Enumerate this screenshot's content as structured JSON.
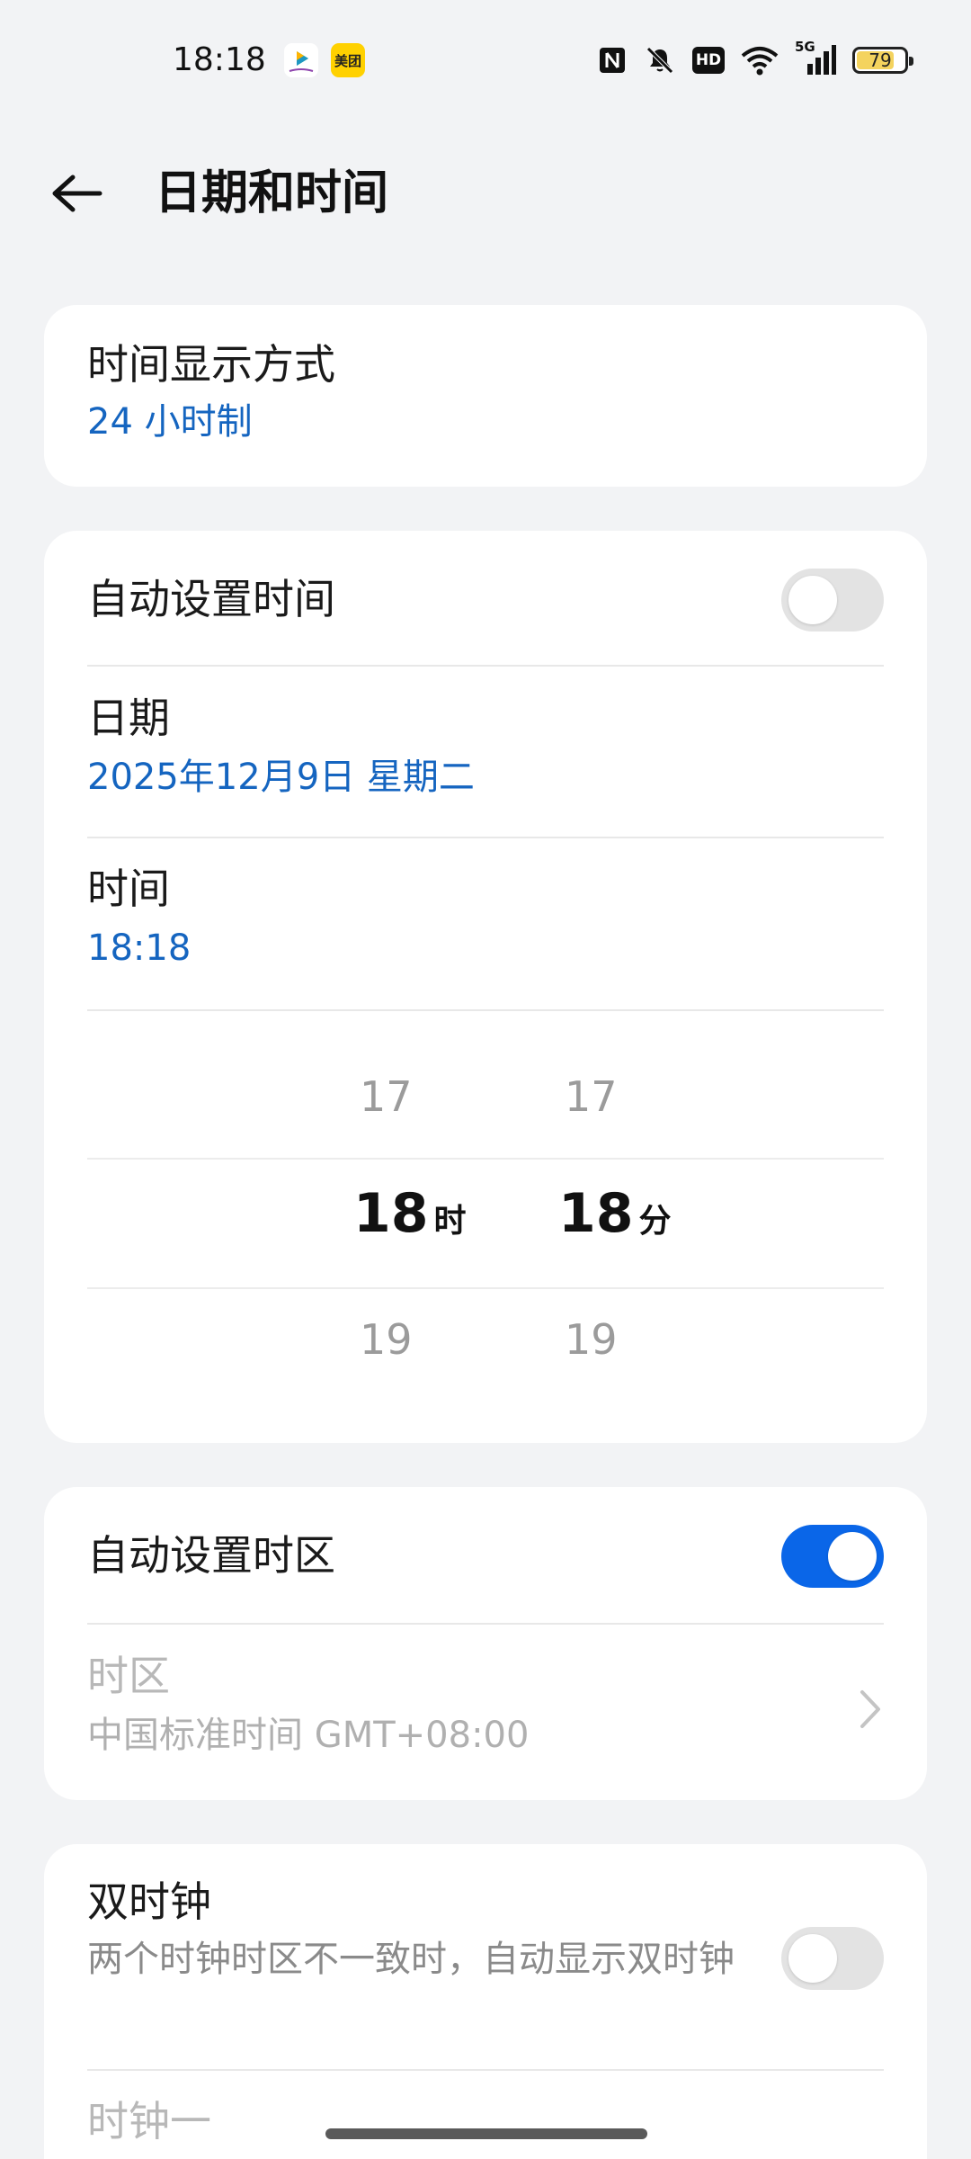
{
  "status_bar": {
    "time": "18:18",
    "meituan_label": "美团",
    "network": "5G",
    "battery": "79",
    "battery_level": 0.79,
    "icons": [
      "nfc-icon",
      "mute-icon",
      "hd-icon",
      "wifi-icon",
      "signal-icon",
      "battery-icon"
    ]
  },
  "header": {
    "title": "日期和时间"
  },
  "time_format": {
    "title": "时间显示方式",
    "value": "24 小时制"
  },
  "auto_time": {
    "title": "自动设置时间",
    "enabled": false
  },
  "date": {
    "title": "日期",
    "value": "2025年12月9日 星期二"
  },
  "time": {
    "title": "时间",
    "value": "18:18"
  },
  "picker": {
    "hour_prev": "17",
    "hour_selected": "18",
    "hour_unit": "时",
    "hour_next": "19",
    "minute_prev": "17",
    "minute_selected": "18",
    "minute_unit": "分",
    "minute_next": "19"
  },
  "auto_timezone": {
    "title": "自动设置时区",
    "enabled": true
  },
  "timezone": {
    "title": "时区",
    "value": "中国标准时间 GMT+08:00"
  },
  "dual_clock": {
    "title": "双时钟",
    "description": "两个时钟时区不一致时，自动显示双时钟",
    "enabled": false
  },
  "clock_one": {
    "title": "时钟一"
  },
  "colors": {
    "accent": "#0a66e8",
    "link": "#1565c0",
    "background": "#f2f3f5"
  }
}
